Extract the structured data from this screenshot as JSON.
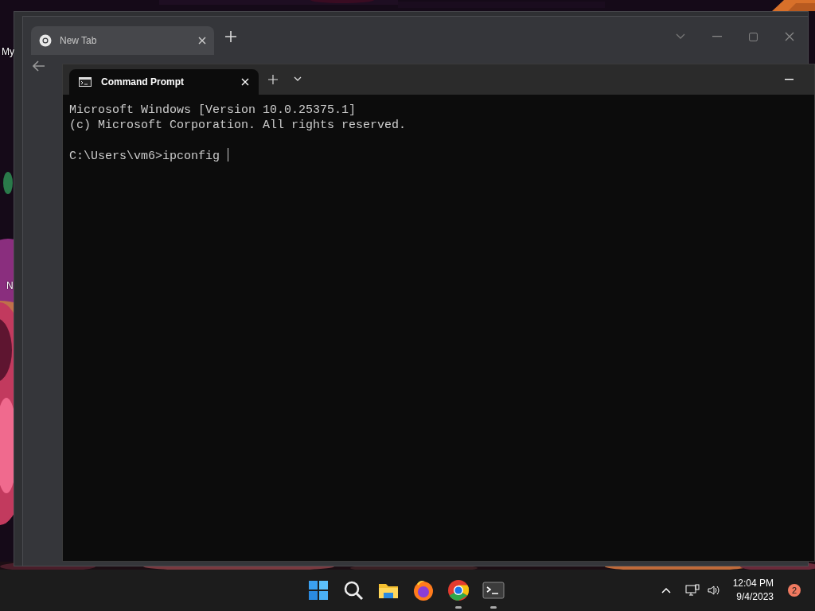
{
  "desktop": {
    "icons": [
      {
        "label": "My"
      },
      {
        "label": "N"
      }
    ]
  },
  "browser": {
    "tabs": [
      {
        "label": "New Tab",
        "selected": true
      }
    ]
  },
  "terminal": {
    "tabs": [
      {
        "label": "Command Prompt",
        "selected": true
      }
    ],
    "output": [
      "Microsoft Windows [Version 10.0.25375.1]",
      "(c) Microsoft Corporation. All rights reserved."
    ],
    "prompt": "C:\\Users\\vm6>ipconfig"
  },
  "taskbar": {
    "apps": [
      {
        "kind": "start",
        "running": false
      },
      {
        "kind": "search",
        "running": false
      },
      {
        "kind": "files",
        "running": false
      },
      {
        "kind": "firefox",
        "running": false
      },
      {
        "kind": "chrome",
        "running": true
      },
      {
        "kind": "terminal",
        "running": true
      }
    ],
    "time": "12:04 PM",
    "date": "9/4/2023",
    "notification_count": "2"
  }
}
